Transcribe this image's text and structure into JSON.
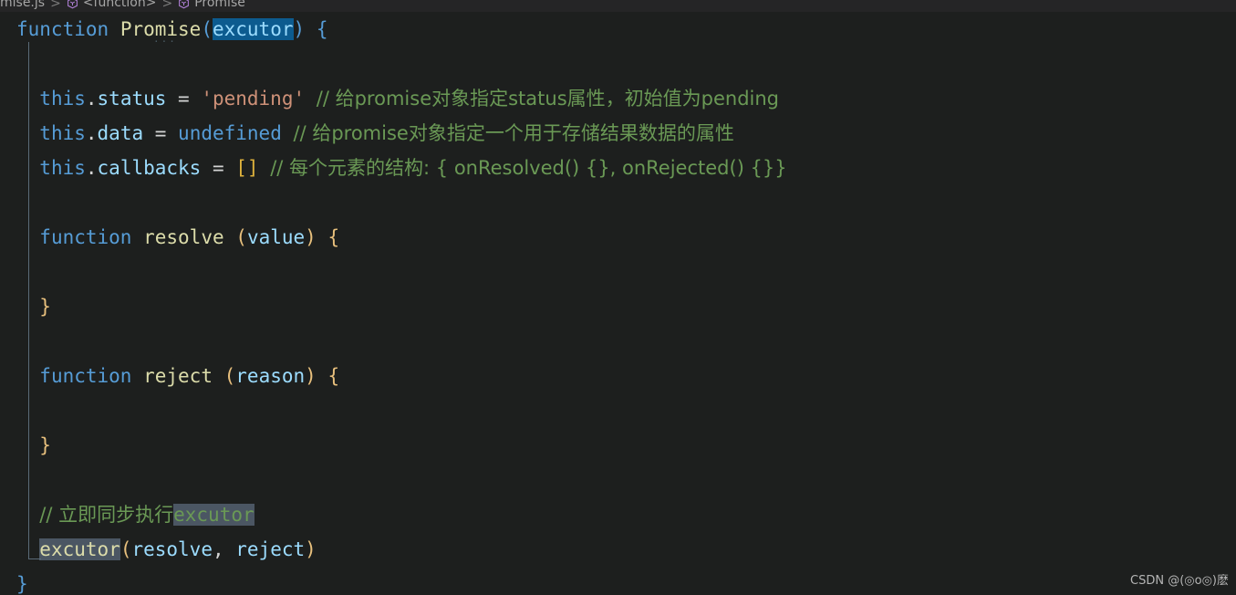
{
  "breadcrumb": {
    "file": "mise.js",
    "separator": ">",
    "crumb2": "<function>",
    "crumb3": "Promise",
    "icon2": "namespace-cube-icon",
    "icon3": "namespace-cube-icon"
  },
  "editor": {
    "language": "javascript",
    "colors": {
      "background": "#1d1f1e",
      "breadcrumb_background": "#252526",
      "keyword": "#569cd6",
      "function_name": "#dcdcaa",
      "parameter": "#9cdcfe",
      "string": "#ce9178",
      "comment": "#6a9955",
      "bracket_blue": "#569cd6",
      "bracket_gold": "#d7ba7d",
      "selection": "#0c5b8f",
      "word_highlight": "#4b5663",
      "guide_line": "#5a6b78"
    },
    "fold_indicator": "..."
  },
  "code": {
    "lines": [
      {
        "id": "line-function-promise",
        "tokens": [
          {
            "t": "function",
            "c": "kw"
          },
          {
            "t": " ",
            "c": "op"
          },
          {
            "t": "Promise",
            "c": "fnname"
          },
          {
            "t": "(",
            "c": "br-blue"
          },
          {
            "t": "excutor",
            "c": "param",
            "hl": "sel"
          },
          {
            "t": ")",
            "c": "br-blue"
          },
          {
            "t": " ",
            "c": "op"
          },
          {
            "t": "{",
            "c": "br-blue"
          }
        ]
      },
      {
        "id": "line-blank-1",
        "tokens": []
      },
      {
        "id": "line-this-status",
        "tokens": [
          {
            "t": "  ",
            "c": "op"
          },
          {
            "t": "this",
            "c": "this"
          },
          {
            "t": ".",
            "c": "op"
          },
          {
            "t": "status",
            "c": "prop"
          },
          {
            "t": " = ",
            "c": "op"
          },
          {
            "t": "'pending'",
            "c": "str"
          },
          {
            "t": " ",
            "c": "op"
          },
          {
            "t": "// 给promise对象指定status属性，初始值为pending",
            "c": "cmt"
          }
        ]
      },
      {
        "id": "line-this-data",
        "tokens": [
          {
            "t": "  ",
            "c": "op"
          },
          {
            "t": "this",
            "c": "this"
          },
          {
            "t": ".",
            "c": "op"
          },
          {
            "t": "data",
            "c": "prop"
          },
          {
            "t": " = ",
            "c": "op"
          },
          {
            "t": "undefined",
            "c": "kw"
          },
          {
            "t": " ",
            "c": "op"
          },
          {
            "t": "// 给promise对象指定一个用于存储结果数据的属性",
            "c": "cmt"
          }
        ]
      },
      {
        "id": "line-this-callbacks",
        "tokens": [
          {
            "t": "  ",
            "c": "op"
          },
          {
            "t": "this",
            "c": "this"
          },
          {
            "t": ".",
            "c": "op"
          },
          {
            "t": "callbacks",
            "c": "prop"
          },
          {
            "t": " = ",
            "c": "op"
          },
          {
            "t": "[]",
            "c": "brack-gold"
          },
          {
            "t": " ",
            "c": "op"
          },
          {
            "t": "// 每个元素的结构: { onResolved() {}, onRejected() {}}",
            "c": "cmt"
          }
        ]
      },
      {
        "id": "line-blank-2",
        "tokens": []
      },
      {
        "id": "line-function-resolve",
        "tokens": [
          {
            "t": "  ",
            "c": "op"
          },
          {
            "t": "function",
            "c": "kw"
          },
          {
            "t": " ",
            "c": "op"
          },
          {
            "t": "resolve",
            "c": "fnname"
          },
          {
            "t": " ",
            "c": "op"
          },
          {
            "t": "(",
            "c": "paren-gold"
          },
          {
            "t": "value",
            "c": "param"
          },
          {
            "t": ")",
            "c": "paren-gold"
          },
          {
            "t": " ",
            "c": "op"
          },
          {
            "t": "{",
            "c": "paren-gold"
          }
        ]
      },
      {
        "id": "line-blank-3",
        "tokens": []
      },
      {
        "id": "line-close-resolve",
        "tokens": [
          {
            "t": "  ",
            "c": "op"
          },
          {
            "t": "}",
            "c": "paren-gold"
          }
        ]
      },
      {
        "id": "line-blank-4",
        "tokens": []
      },
      {
        "id": "line-function-reject",
        "tokens": [
          {
            "t": "  ",
            "c": "op"
          },
          {
            "t": "function",
            "c": "kw"
          },
          {
            "t": " ",
            "c": "op"
          },
          {
            "t": "reject",
            "c": "fnname"
          },
          {
            "t": " ",
            "c": "op"
          },
          {
            "t": "(",
            "c": "paren-gold"
          },
          {
            "t": "reason",
            "c": "param"
          },
          {
            "t": ")",
            "c": "paren-gold"
          },
          {
            "t": " ",
            "c": "op"
          },
          {
            "t": "{",
            "c": "paren-gold"
          }
        ]
      },
      {
        "id": "line-blank-5",
        "tokens": []
      },
      {
        "id": "line-close-reject",
        "tokens": [
          {
            "t": "  ",
            "c": "op"
          },
          {
            "t": "}",
            "c": "paren-gold"
          }
        ]
      },
      {
        "id": "line-blank-6",
        "tokens": []
      },
      {
        "id": "line-comment-execute",
        "tokens": [
          {
            "t": "  ",
            "c": "op"
          },
          {
            "t": "// 立即同步执行",
            "c": "cmt"
          },
          {
            "t": "excutor",
            "c": "cmt",
            "hl": "wordhl"
          }
        ]
      },
      {
        "id": "line-call-excutor",
        "tokens": [
          {
            "t": "  ",
            "c": "op"
          },
          {
            "t": "excutor",
            "c": "ident-y",
            "hl": "wordhl"
          },
          {
            "t": "(",
            "c": "paren-gold"
          },
          {
            "t": "resolve",
            "c": "var"
          },
          {
            "t": ", ",
            "c": "op"
          },
          {
            "t": "reject",
            "c": "var"
          },
          {
            "t": ")",
            "c": "paren-gold"
          }
        ]
      },
      {
        "id": "line-close-promise",
        "tokens": [
          {
            "t": "}",
            "c": "br-blue"
          }
        ]
      }
    ]
  },
  "watermark": {
    "text": "CSDN @(◎o◎)麽"
  }
}
